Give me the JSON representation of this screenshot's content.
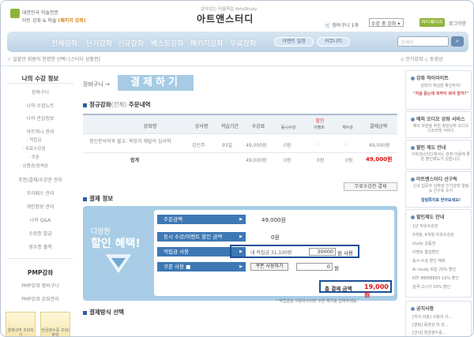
{
  "header": {
    "tagline_line1": "대한민국 미술전문",
    "tagline_line2_prefix": "아트 강좌 & 미술",
    "tagline_line2_highlight": "(패키지 강좌)",
    "site_subtitle": "살아있는 미술학습 ArtoStudy",
    "site_name": "아트앤스터디",
    "cart_label": "장바구니 1개",
    "select_value": "수강 중 강좌",
    "mypage_label": "마이페이지",
    "logout_label": "로그아웃"
  },
  "nav": {
    "items": [
      "전체강좌",
      "단기강좌",
      "신규강좌",
      "베스트강좌",
      "패키지강좌",
      "무료강좌"
    ],
    "pills": [
      "이벤트 일정",
      "커뮤니티"
    ],
    "search_placeholder": "검색어",
    "notice": "☆ 일할만 회원의 현명한 선택! [스터디 상품권]",
    "right_links": "◇ 인기강좌  ◇ 동영상"
  },
  "sidebar": {
    "title": "나의 수강 정보",
    "items": [
      "장바구니",
      "나의 수업노트",
      "나의 관심정보",
      "아트머니 관리"
    ],
    "subitems": [
      "· 적립금",
      "· 무료수강권",
      "· 쿠폰",
      "· 상품권/정액권"
    ],
    "items2": [
      "주문/결제/수강권 관리",
      "프리패스 관리",
      "개인정보 관리",
      "나의 Q&A",
      "수료증 발급",
      "영수증 출력"
    ],
    "section2_title": "PMP강좌",
    "items3": [
      "PMP강좌 장바구니",
      "PMP강좌 강좌관리"
    ],
    "buttons": [
      "결제내역 조회하기",
      "현금영수증 조회/출력"
    ]
  },
  "main": {
    "breadcrumb": "장바구니 →",
    "title": "결제하기",
    "section1_title": "정규강좌",
    "section1_sub": "(전체)",
    "section1_suffix": "주문내역",
    "table": {
      "headers": [
        "강좌명",
        "강사명",
        "학습기간",
        "수강료",
        "할인",
        "결제금액"
      ],
      "discount_subheaders": [
        "동시수강",
        "이벤트",
        "재수강"
      ],
      "row": {
        "name": "정신분석학과 불교: 욕망과 해탈의 심리학",
        "teacher": "강신주",
        "period": "93일",
        "fee": "49,000원",
        "d1": "0원",
        "d2": "-",
        "d3": "-",
        "total": "49,000원"
      },
      "sum": {
        "label": "합계",
        "fee": "49,000원",
        "d1": "0원",
        "d2": "0원",
        "d3": "0원",
        "total": "49,000원"
      }
    },
    "free_coupon_button": "무료수강권 결제",
    "section2_title": "결제 정보",
    "promo_line1": "다양한",
    "promo_line2": "할인 혜택!",
    "payment": {
      "order_label": "주문금액",
      "order_value": "49,000원",
      "event_label": "동시 수강/이벤트 할인 금액",
      "event_value": "0원",
      "point_label": "적립금 사용",
      "point_text": "내 적립금 31,100원",
      "point_input": "30000",
      "point_suffix": "원 사용",
      "coupon_label": "쿠폰 사용",
      "coupon_button": "쿠폰 사용하기",
      "coupon_input": "0",
      "coupon_suffix": "원",
      "total_label": "총 결제 금액",
      "total_value": "19,000 원"
    },
    "note": "* 적립금을 사용하시려면 쿠폰 체크를 없애주세요.",
    "section3_title": "결제방식 선택"
  },
  "right": {
    "card1_title": "강좌 하이라이트",
    "card1_text": "강좌의 핵심만 확인하자!",
    "card1_quote": "\"처음 듣는데 뭐부터 봐야 할까?\"",
    "card2_title": "예외 오디오 강좌 서비스",
    "card2_text": "예외 학원을 위한 청강강좌 오디오 스트리밍 서비스",
    "card3_title": "할인 제도 안내",
    "card3_text": "아트앤스터디에서는 강좌 이용에 좋은 할인제도가 있습니다.",
    "card4_title": "아트앤스터디 선구독",
    "card4_text": "신규 입문자 강좌와 인기강좌 알림 & 선구독 소식",
    "card4_highlight": "알림쪽지로 받아보세요!",
    "list_title": "할인제도 안내",
    "list": [
      "1년 자유수강권",
      "3개월, 6개월 자유수강권",
      "study 상품권",
      "이벤트 통합할인",
      "동시 수강 할인 혜택",
      "Ar study 회원 20% 할인",
      "KTF MEMBERS 10% 할인",
      "합격 고시가 20% 할인"
    ],
    "notice_title": "공지사항",
    "notices": [
      "[지식 미술] 사람의 사...",
      "[알림] 동영상 미 관...",
      "[안내] 현금영수증..."
    ]
  }
}
